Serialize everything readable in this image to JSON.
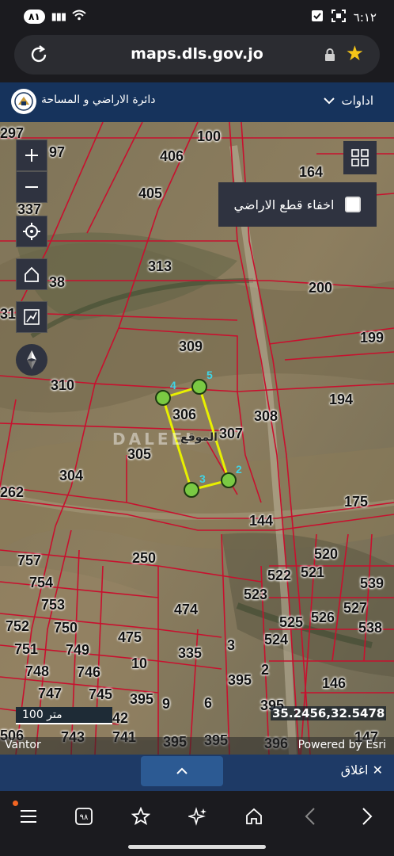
{
  "status": {
    "battery": "٨١",
    "time": "٦:١٢"
  },
  "browser": {
    "url": "maps.dls.gov.jo"
  },
  "header": {
    "title": "دائرة الاراضي و المساحة",
    "tools_label": "اداوات"
  },
  "map": {
    "toggle_label": "اخفاء قطع الاراضي",
    "toggle_checked": false,
    "scale_label": "100 متر",
    "coordinates": "35.2456,32.5478",
    "attribution_left": "Vantor",
    "attribution_right": "Powered by Esri",
    "watermark": "DALEEL",
    "parcels": [
      "297",
      "97",
      "100",
      "406",
      "164",
      "405",
      "337",
      "38",
      "313",
      "200",
      "31",
      "309",
      "199",
      "310",
      "194",
      "306",
      "308",
      "307",
      "305",
      "304",
      "262",
      "175",
      "144",
      "520",
      "250",
      "757",
      "754",
      "522",
      "521",
      "539",
      "753",
      "523",
      "474",
      "527",
      "752",
      "750",
      "525",
      "526",
      "538",
      "751",
      "749",
      "475",
      "524",
      "748",
      "746",
      "10",
      "335",
      "3",
      "395",
      "2",
      "146",
      "747",
      "745",
      "395",
      "9",
      "6",
      "395",
      "42",
      "743",
      "741",
      "395",
      "395",
      "506",
      "396",
      "147"
    ],
    "vertex_labels": [
      "4",
      "5",
      "2",
      "3"
    ],
    "parcel_label": "الموقع"
  },
  "bottom": {
    "close_label": "اغلاق"
  },
  "colors": {
    "header_bg": "#16335c",
    "parcel_lines": "#c8102e",
    "selection": "#e8f000",
    "vertex": "#7ac943"
  }
}
